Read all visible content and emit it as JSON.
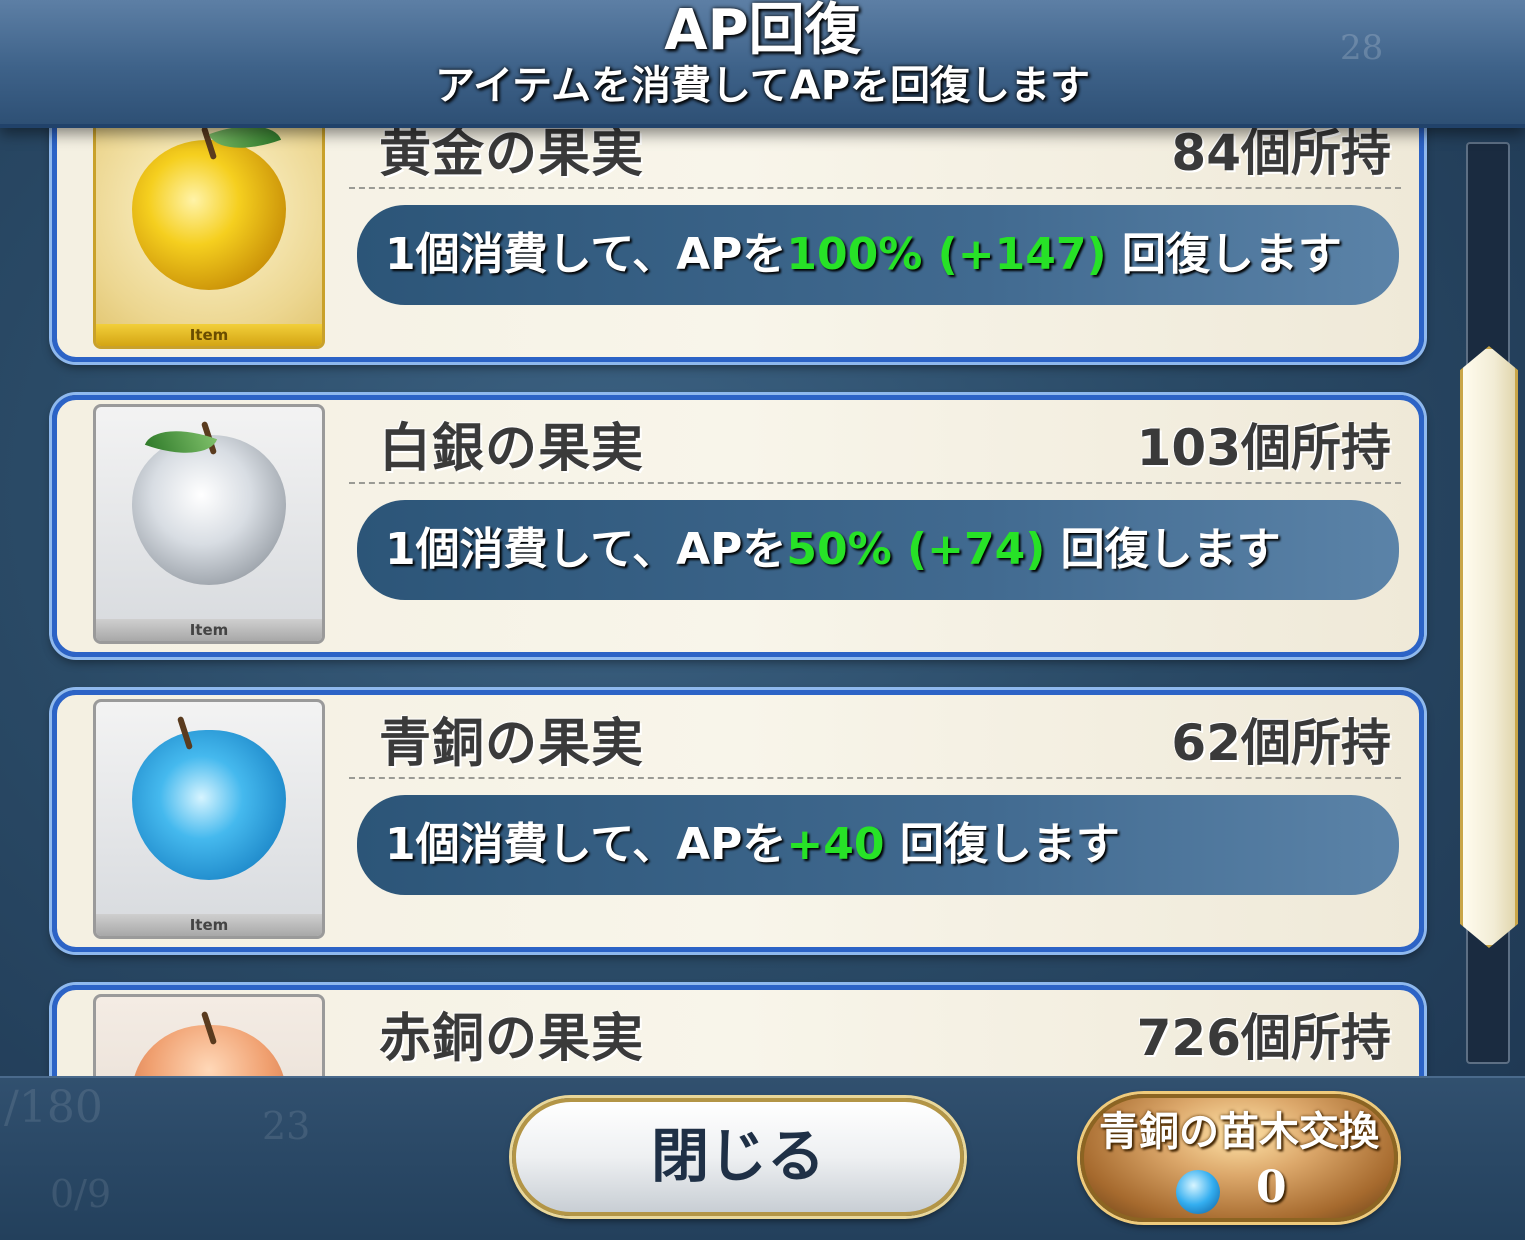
{
  "header": {
    "title": "AP回復",
    "subtitle": "アイテムを消費してAPを回復します",
    "bg_number": "28"
  },
  "items": [
    {
      "name": "黄金の果実",
      "count": "84",
      "count_suffix": "個所持",
      "thumb_label": "Item",
      "effect_prefix": "1個消費して、APを",
      "effect_value": "100% (+147)",
      "effect_suffix": " 回復します",
      "apple_color": "gold",
      "icon": "golden-apple-icon"
    },
    {
      "name": "白銀の果実",
      "count": "103",
      "count_suffix": "個所持",
      "thumb_label": "Item",
      "effect_prefix": "1個消費して、APを",
      "effect_value": "50% (+74)",
      "effect_suffix": " 回復します",
      "apple_color": "silver",
      "icon": "silver-apple-icon"
    },
    {
      "name": "青銅の果実",
      "count": "62",
      "count_suffix": "個所持",
      "thumb_label": "Item",
      "effect_prefix": "1個消費して、APを",
      "effect_value": "+40",
      "effect_suffix": " 回復します",
      "apple_color": "blue",
      "icon": "bronze-apple-icon"
    },
    {
      "name": "赤銅の果実",
      "count": "726",
      "count_suffix": "個所持",
      "apple_color": "red",
      "icon": "copper-apple-icon"
    }
  ],
  "footer": {
    "close_label": "閉じる",
    "exchange_label": "青銅の苗木交換",
    "exchange_count": "0",
    "bg_ghost_a": "/180",
    "bg_ghost_b": "0/9",
    "bg_ghost_c": "23"
  },
  "colors": {
    "highlight": "#27e227",
    "card_border": "#2c63c6"
  }
}
